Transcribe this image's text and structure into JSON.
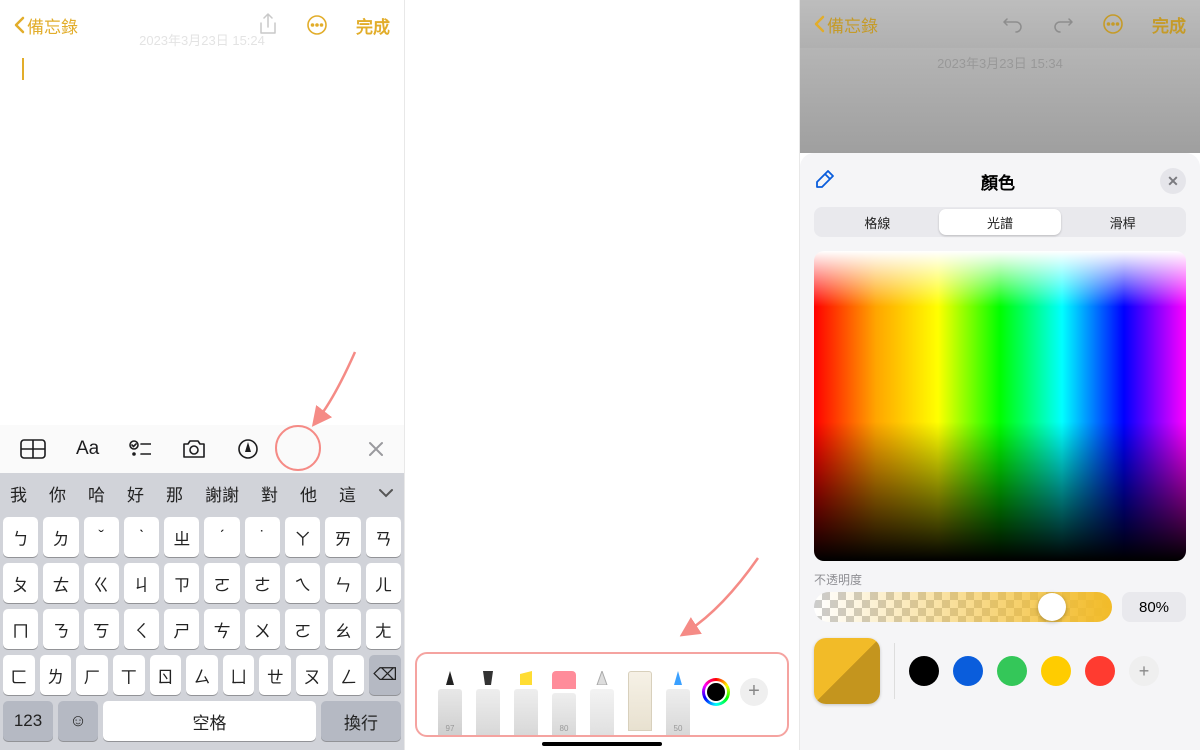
{
  "col1": {
    "back_label": "備忘錄",
    "done": "完成",
    "ghost_date": "2023年3月23日 15:24",
    "suggestions": [
      "我",
      "你",
      "哈",
      "好",
      "那",
      "謝謝",
      "對",
      "他",
      "這"
    ],
    "row1": [
      "ㄅ",
      "ㄉ",
      "ˇ",
      "ˋ",
      "ㄓ",
      "ˊ",
      "˙",
      "ㄚ",
      "ㄞ",
      "ㄢ"
    ],
    "row2": [
      "ㄆ",
      "ㄊ",
      "ㄍ",
      "ㄐ",
      "ㄗ",
      "ㄛ",
      "ㄜ",
      "ㄟ",
      "ㄣ",
      "ㄦ"
    ],
    "row3": [
      "ㄇ",
      "ㄋ",
      "ㄎ",
      "ㄑ",
      "ㄕ",
      "ㄘ",
      "ㄨ",
      "ㄛ",
      "ㄠ",
      "ㄤ"
    ],
    "row4": [
      "ㄈ",
      "ㄌ",
      "ㄏ",
      "ㄒ",
      "ㄖ",
      "ㄙ",
      "ㄩ",
      "ㄝ",
      "ㄡ",
      "ㄥ",
      "⌫"
    ],
    "key123": "123",
    "emoji": "☺",
    "space": "空格",
    "return": "換行"
  },
  "col2": {
    "tool_labels": {
      "pen": "97",
      "crayon": "80",
      "pencil": "50"
    },
    "add": "+"
  },
  "col3": {
    "back_label": "備忘錄",
    "done": "完成",
    "ghost_date": "2023年3月23日 15:34",
    "sheet_title": "顏色",
    "segments": {
      "grid": "格線",
      "spectrum": "光譜",
      "slider": "滑桿"
    },
    "opacity_label": "不透明度",
    "opacity_value": "80%",
    "swatch_colors": [
      "#000000",
      "#0a5ddc",
      "#34c759",
      "#ffcc00",
      "#ff3b30"
    ],
    "add": "+"
  }
}
